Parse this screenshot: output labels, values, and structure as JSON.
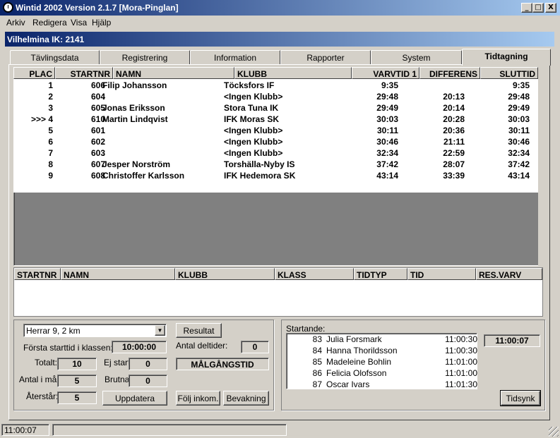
{
  "window": {
    "title": "Wintid 2002   Version 2.1.7 [Mora-Pinglan]",
    "min_label": "_",
    "max_label": "□",
    "close_label": "X"
  },
  "menu": [
    "Arkiv",
    "Redigera",
    "Visa",
    "Hjälp"
  ],
  "club_bar": "Vilhelmina IK: 2141",
  "tabs": [
    "Tävlingsdata",
    "Registrering",
    "Information",
    "Rapporter",
    "System",
    "Tidtagning"
  ],
  "active_tab": "Tidtagning",
  "results": {
    "headers": [
      "PLAC",
      "STARTNR",
      "NAMN",
      "KLUBB",
      "VARVTID 1",
      "DIFFERENS",
      "SLUTTID"
    ],
    "rows": [
      {
        "plac": "1",
        "startnr": "606",
        "namn": "Filip Johansson",
        "klubb": "Töcksfors IF",
        "varvtid": "9:35",
        "diff": "",
        "sluttid": "9:35"
      },
      {
        "plac": "2",
        "startnr": "604",
        "namn": ".",
        "klubb": "<Ingen Klubb>",
        "varvtid": "29:48",
        "diff": "20:13",
        "sluttid": "29:48"
      },
      {
        "plac": "3",
        "startnr": "605",
        "namn": "Jonas Eriksson",
        "klubb": "Stora Tuna IK",
        "varvtid": "29:49",
        "diff": "20:14",
        "sluttid": "29:49"
      },
      {
        "plac": ">>> 4",
        "startnr": "610",
        "namn": "Martin Lindqvist",
        "klubb": "IFK Moras SK",
        "varvtid": "30:03",
        "diff": "20:28",
        "sluttid": "30:03"
      },
      {
        "plac": "5",
        "startnr": "601",
        "namn": ".",
        "klubb": "<Ingen Klubb>",
        "varvtid": "30:11",
        "diff": "20:36",
        "sluttid": "30:11"
      },
      {
        "plac": "6",
        "startnr": "602",
        "namn": ".",
        "klubb": "<Ingen Klubb>",
        "varvtid": "30:46",
        "diff": "21:11",
        "sluttid": "30:46"
      },
      {
        "plac": "7",
        "startnr": "603",
        "namn": ".",
        "klubb": "<Ingen Klubb>",
        "varvtid": "32:34",
        "diff": "22:59",
        "sluttid": "32:34"
      },
      {
        "plac": "8",
        "startnr": "607",
        "namn": "Jesper Norström",
        "klubb": "Torshälla-Nyby IS",
        "varvtid": "37:42",
        "diff": "28:07",
        "sluttid": "37:42"
      },
      {
        "plac": "9",
        "startnr": "608",
        "namn": "Christoffer Karlsson",
        "klubb": "IFK Hedemora SK",
        "varvtid": "43:14",
        "diff": "33:39",
        "sluttid": "43:14"
      }
    ]
  },
  "grid2": {
    "headers": [
      "STARTNR",
      "NAMN",
      "KLUBB",
      "KLASS",
      "TIDTYP",
      "TID",
      "RES.VARV"
    ]
  },
  "controls": {
    "class_select": "Herrar 9, 2 km",
    "first_start_label": "Första starttid i klassen:",
    "first_start_value": "10:00:00",
    "total_label": "Totalt:",
    "total_value": "10",
    "ej_start_label": "Ej start:",
    "ej_start_value": "0",
    "in_goal_label": "Antal i mål:",
    "in_goal_value": "5",
    "brutna_label": "Brutna:",
    "brutna_value": "0",
    "remaining_label": "Återstår:",
    "remaining_value": "5",
    "update_button": "Uppdatera",
    "result_button": "Resultat",
    "split_label": "Antal deltider:",
    "split_value": "0",
    "finish_time_button": "MÅLGÅNGSTID",
    "follow_button": "Följ inkom.",
    "watch_button": "Bevakning"
  },
  "starters": {
    "label": "Startande:",
    "clock": "11:00:07",
    "sync_button": "Tidsynk",
    "rows": [
      {
        "nr": "83",
        "name": "Julia Forsmark",
        "time": "11:00:30"
      },
      {
        "nr": "84",
        "name": "Hanna Thorildsson",
        "time": "11:00:30"
      },
      {
        "nr": "85",
        "name": "Madeleine Bohlin",
        "time": "11:01:00"
      },
      {
        "nr": "86",
        "name": "Felicia Olofsson",
        "time": "11:01:00"
      },
      {
        "nr": "87",
        "name": "Oscar Ivars",
        "time": "11:01:30"
      }
    ]
  },
  "status": {
    "time": "11:00:07"
  }
}
